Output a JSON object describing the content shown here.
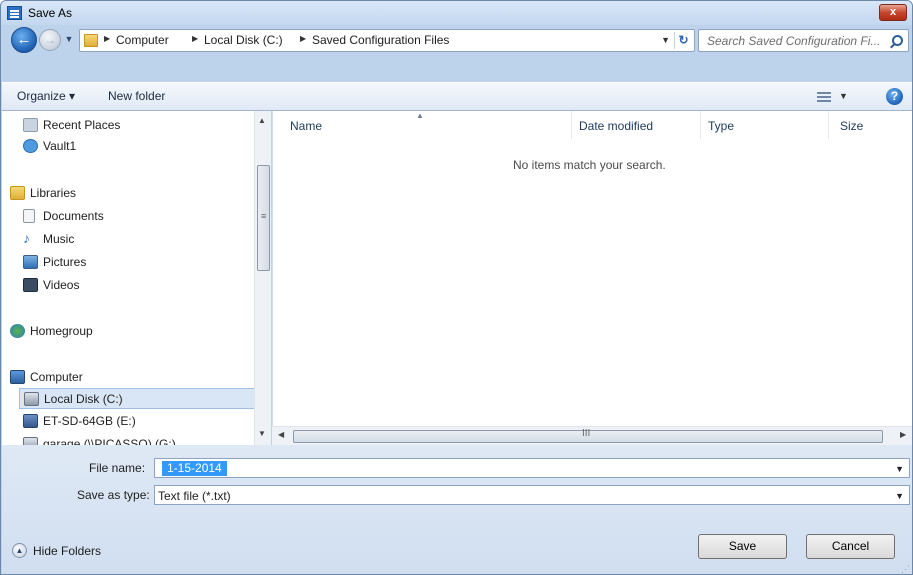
{
  "window": {
    "title": "Save As",
    "close_glyph": "x"
  },
  "nav": {
    "back_glyph": "←",
    "forward_glyph": "→",
    "breadcrumbs": [
      "Computer",
      "Local Disk (C:)",
      "Saved Configuration Files"
    ],
    "search_placeholder": "Search Saved Configuration Fi..."
  },
  "toolbar": {
    "organize": "Organize ▾",
    "new_folder": "New folder",
    "help_glyph": "?"
  },
  "sidebar": {
    "items": [
      {
        "label": "Recent Places",
        "icon": "recent-places-icon"
      },
      {
        "label": "Vault1",
        "icon": "vault-icon"
      },
      {
        "label": "Libraries",
        "icon": "libraries-icon"
      },
      {
        "label": "Documents",
        "icon": "documents-icon"
      },
      {
        "label": "Music",
        "icon": "music-icon"
      },
      {
        "label": "Pictures",
        "icon": "pictures-icon"
      },
      {
        "label": "Videos",
        "icon": "videos-icon"
      },
      {
        "label": "Homegroup",
        "icon": "homegroup-icon"
      },
      {
        "label": "Computer",
        "icon": "computer-icon"
      },
      {
        "label": "Local Disk (C:)",
        "icon": "local-disk-icon",
        "selected": true
      },
      {
        "label": "ET-SD-64GB (E:)",
        "icon": "usb-drive-icon"
      },
      {
        "label": "garage (\\\\PICASSO) (G:)",
        "icon": "network-drive-icon"
      }
    ]
  },
  "files": {
    "columns": [
      "Name",
      "Date modified",
      "Type",
      "Size"
    ],
    "empty_message": "No items match your search."
  },
  "form": {
    "file_name_label": "File name:",
    "file_name_value": "1-15-2014",
    "save_as_type_label": "Save as type:",
    "save_as_type_value": "Text file (*.txt)"
  },
  "footer": {
    "hide_folders": "Hide Folders",
    "save": "Save",
    "cancel": "Cancel"
  },
  "colors": {
    "selection": "#3399ff",
    "chrome": "#bdd3ec",
    "accent": "#2a6fc4"
  }
}
